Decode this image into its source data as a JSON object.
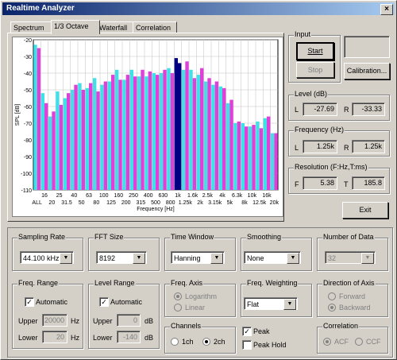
{
  "window": {
    "title": "Realtime Analyzer",
    "close_glyph": "×"
  },
  "tabs": [
    "Spectrum",
    "1/3 Octave",
    "Waterfall",
    "Correlation"
  ],
  "active_tab": 1,
  "chart_data": {
    "type": "bar",
    "ylabel": "SPL [dB]",
    "xlabel": "Frequency  [Hz]",
    "ylim": [
      -110,
      -20
    ],
    "yticks": [
      "-20",
      "-30",
      "-40",
      "-50",
      "-60",
      "-70",
      "-80",
      "-90",
      "-100",
      "-110"
    ],
    "xtick_row1": [
      "16",
      "25",
      "40",
      "63",
      "100",
      "160",
      "250",
      "400",
      "630",
      "1k",
      "1.6k",
      "2.5k",
      "4k",
      "6.3k",
      "10k",
      "16k"
    ],
    "xtick_row2": [
      "ALL",
      "20",
      "31.5",
      "50",
      "80",
      "125",
      "200",
      "315",
      "500",
      "800",
      "1.25k",
      "2k",
      "3.15k",
      "5k",
      "8k",
      "12.5k",
      "20k"
    ],
    "categories": [
      "ALL",
      "16",
      "20",
      "25",
      "31.5",
      "40",
      "50",
      "63",
      "80",
      "100",
      "125",
      "160",
      "200",
      "250",
      "315",
      "400",
      "500",
      "630",
      "800",
      "1k",
      "1.25k",
      "1.6k",
      "2k",
      "2.5k",
      "3.15k",
      "4k",
      "5k",
      "6.3k",
      "8k",
      "10k",
      "12.5k",
      "16k",
      "20k"
    ],
    "series": [
      {
        "name": "L",
        "color": "#40e0e8",
        "values": [
          -23,
          -52,
          -66,
          -51,
          -55,
          -50,
          -46,
          -49,
          -43,
          -47,
          -45,
          -38,
          -44,
          -38,
          -42,
          -42,
          -40,
          -40,
          -37,
          -31,
          -38,
          -38,
          -41,
          -45,
          -47,
          -48,
          -58,
          -70,
          -70,
          -72,
          -69,
          -67,
          -76
        ]
      },
      {
        "name": "R",
        "color": "#e040d8",
        "values": [
          -25,
          -58,
          -63,
          -59,
          -52,
          -47,
          -50,
          -46,
          -51,
          -45,
          -41,
          -44,
          -41,
          -42,
          -38,
          -39,
          -41,
          -38,
          -40,
          -34,
          -33,
          -43,
          -37,
          -43,
          -45,
          -49,
          -56,
          -69,
          -72,
          -71,
          -73,
          -66,
          -76
        ]
      }
    ],
    "highlight_category": "1k",
    "highlight_color": "#000080",
    "grid": true,
    "background": "#ffffff"
  },
  "input": {
    "label": "Input",
    "start": "Start",
    "stop": "Stop",
    "calibration": "Calibration..."
  },
  "level": {
    "label": "Level (dB)",
    "l_label": "L",
    "l_value": "-27.69",
    "r_label": "R",
    "r_value": "-33.33"
  },
  "frequency": {
    "label": "Frequency (Hz)",
    "l_label": "L",
    "l_value": "1.25k",
    "r_label": "R",
    "r_value": "1.25k"
  },
  "resolution": {
    "label": "Resolution (F:Hz,T:ms)",
    "f_label": "F",
    "f_value": "5.38",
    "t_label": "T",
    "t_value": "185.8"
  },
  "exit": "Exit",
  "sampling_rate": {
    "label": "Sampling Rate",
    "value": "44.100 kHz"
  },
  "fft_size": {
    "label": "FFT Size",
    "value": "8192"
  },
  "time_window": {
    "label": "Time Window",
    "value": "Hanning"
  },
  "smoothing": {
    "label": "Smoothing",
    "value": "None"
  },
  "number_of_data": {
    "label": "Number of Data",
    "value": "32"
  },
  "freq_range": {
    "label": "Freq. Range",
    "auto_label": "Automatic",
    "upper_label": "Upper",
    "upper_value": "20000",
    "upper_unit": "Hz",
    "lower_label": "Lower",
    "lower_value": "20",
    "lower_unit": "Hz"
  },
  "level_range": {
    "label": "Level Range",
    "auto_label": "Automatic",
    "upper_label": "Upper",
    "upper_value": "0",
    "upper_unit": "dB",
    "lower_label": "Lower",
    "lower_value": "-140",
    "lower_unit": "dB"
  },
  "freq_axis": {
    "label": "Freq. Axis",
    "opt1": "Logarithm",
    "opt2": "Linear"
  },
  "channels": {
    "label": "Channels",
    "opt1": "1ch",
    "opt2": "2ch"
  },
  "freq_weighting": {
    "label": "Freq. Weighting",
    "value": "Flat"
  },
  "peak": {
    "peak_label": "Peak",
    "peak_hold_label": "Peak Hold"
  },
  "direction": {
    "label": "Direction of Axis",
    "opt1": "Forward",
    "opt2": "Backward"
  },
  "correlation": {
    "label": "Correlation",
    "opt1": "ACF",
    "opt2": "CCF"
  },
  "check_glyph": "✓"
}
